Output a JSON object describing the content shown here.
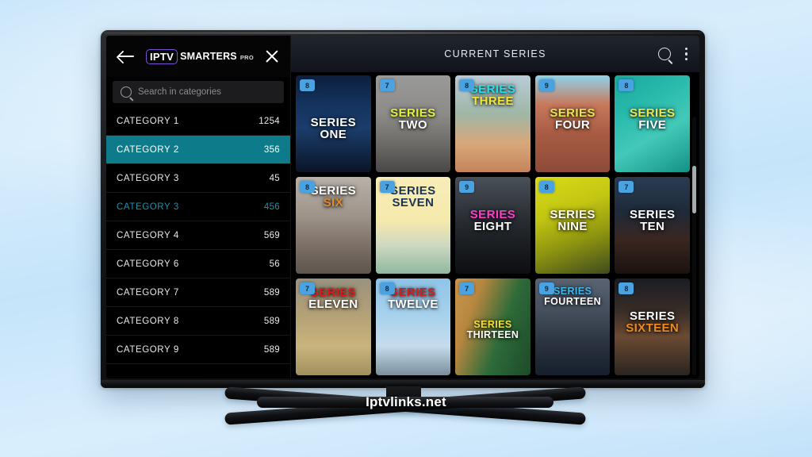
{
  "watermark": "Iptvlinks.net",
  "sidebar": {
    "logo": {
      "iptv": "IPTV",
      "smarters": "SMARTERS",
      "pro": "PRO"
    },
    "back_label": "back-arrow",
    "close_label": "close",
    "search": {
      "placeholder": "Search in categories",
      "value": ""
    },
    "categories": [
      {
        "name": "CATEGORY  1",
        "count": "1254",
        "state": "normal"
      },
      {
        "name": "CATEGORY  2",
        "count": "356",
        "state": "selected"
      },
      {
        "name": "CATEGORY  3",
        "count": "45",
        "state": "normal"
      },
      {
        "name": "CATEGORY  3",
        "count": "456",
        "state": "accent"
      },
      {
        "name": "CATEGORY  4",
        "count": "569",
        "state": "normal"
      },
      {
        "name": "CATEGORY  6",
        "count": "56",
        "state": "normal"
      },
      {
        "name": "CATEGORY  7",
        "count": "589",
        "state": "normal"
      },
      {
        "name": "CATEGORY  8",
        "count": "589",
        "state": "normal"
      },
      {
        "name": "CATEGORY  9",
        "count": "589",
        "state": "normal"
      }
    ],
    "selected_color": "#0d7b8a",
    "accent_color": "#1c93a8"
  },
  "topbar": {
    "title": "CURRENT SERIES",
    "search_icon": "search-icon",
    "menu_icon": "more-vertical-icon"
  },
  "grid": {
    "tiles": [
      {
        "badge": "8",
        "line1": "SERIES",
        "line2": "ONE",
        "c1": "#ffffff",
        "c2": "#ffffff",
        "pos": "pos-low",
        "size": "",
        "art": "linear-gradient(180deg,#0d1f3c 0%,#14335e 30%,#1b3d6b 55%,#0a1426 100%)"
      },
      {
        "badge": "7",
        "line1": "SERIES",
        "line2": "TWO",
        "c1": "#e3f23a",
        "c2": "#ffffff",
        "pos": "pos-mid",
        "size": "",
        "art": "linear-gradient(180deg,#9a9a98 0%,#8d8b88 40%,#6e6c69 70%,#4a4846 100%)"
      },
      {
        "badge": "8",
        "line1": "SERIES",
        "line2": "THREE",
        "c1": "#27e0e8",
        "c2": "#f2e636",
        "pos": "pos-top",
        "size": "",
        "art": "linear-gradient(180deg,#b9ccd8 0%,#9fb6a6 40%,#d8a87a 70%,#c4845c 100%)"
      },
      {
        "badge": "9",
        "line1": "SERIES",
        "line2": "FOUR",
        "c1": "#e8e84a",
        "c2": "#ffffff",
        "pos": "pos-mid",
        "size": "",
        "art": "linear-gradient(180deg,#8fd3ea 0%,#c8795c 30%,#a85c44 60%,#8d4a38 100%)"
      },
      {
        "badge": "8",
        "line1": "SERIES",
        "line2": "FIVE",
        "c1": "#f0e84c",
        "c2": "#ffffff",
        "pos": "pos-mid",
        "size": "",
        "art": "linear-gradient(150deg,#17a89c 0%,#2cbcae 35%,#43c9b8 60%,#139186 100%)"
      },
      {
        "badge": "8",
        "line1": "SERIES",
        "line2": "SIX",
        "c1": "#ffffff",
        "c2": "#e08a2e",
        "pos": "pos-top",
        "size": "",
        "art": "linear-gradient(180deg,#b8b2aa 0%,#9e948a 40%,#7d7168 70%,#5d544c 100%)"
      },
      {
        "badge": "7",
        "line1": "SERIES",
        "line2": "SEVEN",
        "c1": "#1b3350",
        "c2": "#1b3350",
        "pos": "pos-top",
        "size": "",
        "art": "linear-gradient(180deg,#f7edb8 0%,#f5e9ac 45%,#cfd9c0 70%,#8fb8a0 100%)"
      },
      {
        "badge": "9",
        "line1": "SERIES",
        "line2": "EIGHT",
        "c1": "#ff3ecb",
        "c2": "#ffffff",
        "pos": "pos-mid",
        "size": "",
        "art": "linear-gradient(180deg,#4a5058 0%,#2b3036 40%,#1a1d21 70%,#0c0e11 100%)"
      },
      {
        "badge": "8",
        "line1": "SERIES",
        "line2": "NINE",
        "c1": "#ffffff",
        "c2": "#ffffff",
        "pos": "pos-mid",
        "size": "",
        "art": "linear-gradient(160deg,#d8dc18 0%,#c3c612 35%,#8d9410 65%,#3f4a1e 100%)"
      },
      {
        "badge": "7",
        "line1": "SERIES",
        "line2": "TEN",
        "c1": "#ffffff",
        "c2": "#ffffff",
        "pos": "pos-mid",
        "size": "",
        "art": "linear-gradient(180deg,#2b3c52 0%,#1e2a3a 35%,#3a2620 65%,#1a1210 100%)"
      },
      {
        "badge": "7",
        "line1": "SERIES",
        "line2": "ELEVEN",
        "c1": "#e31b1b",
        "c2": "#ffffff",
        "pos": "pos-top",
        "size": "",
        "art": "linear-gradient(180deg,#9a927f 0%,#b5a276 40%,#c9b47e 70%,#a08f5e 100%)"
      },
      {
        "badge": "8",
        "line1": "SERIES",
        "line2": "TWELVE",
        "c1": "#d42020",
        "c2": "#ffffff",
        "pos": "pos-top",
        "size": "",
        "art": "linear-gradient(180deg,#8fc4e8 0%,#a9d2ec 40%,#c6dced 70%,#7a8e9a 100%)"
      },
      {
        "badge": "7",
        "line1": "SERIES",
        "line2": "THIRTEEN",
        "c1": "#f2e234",
        "c2": "#ffffff",
        "pos": "pos-low",
        "size": "small",
        "art": "linear-gradient(110deg,#c9954e 0%,#b8873f 25%,#2e6b3a 60%,#1d4a28 100%)"
      },
      {
        "badge": "9",
        "line1": "SERIES",
        "line2": "FOURTEEN",
        "c1": "#3fb8ef",
        "c2": "#ffffff",
        "pos": "pos-top",
        "size": "small",
        "art": "linear-gradient(180deg,#5a6472 0%,#454e5c 35%,#2b3440 65%,#16202c 100%)"
      },
      {
        "badge": "8",
        "line1": "SERIES",
        "line2": "SIXTEEN",
        "c1": "#ffffff",
        "c2": "#f08a1e",
        "pos": "pos-mid",
        "size": "",
        "art": "linear-gradient(180deg,#1a1c24 0%,#3a2e28 35%,#6b4a32 60%,#2a2420 100%)"
      }
    ]
  }
}
